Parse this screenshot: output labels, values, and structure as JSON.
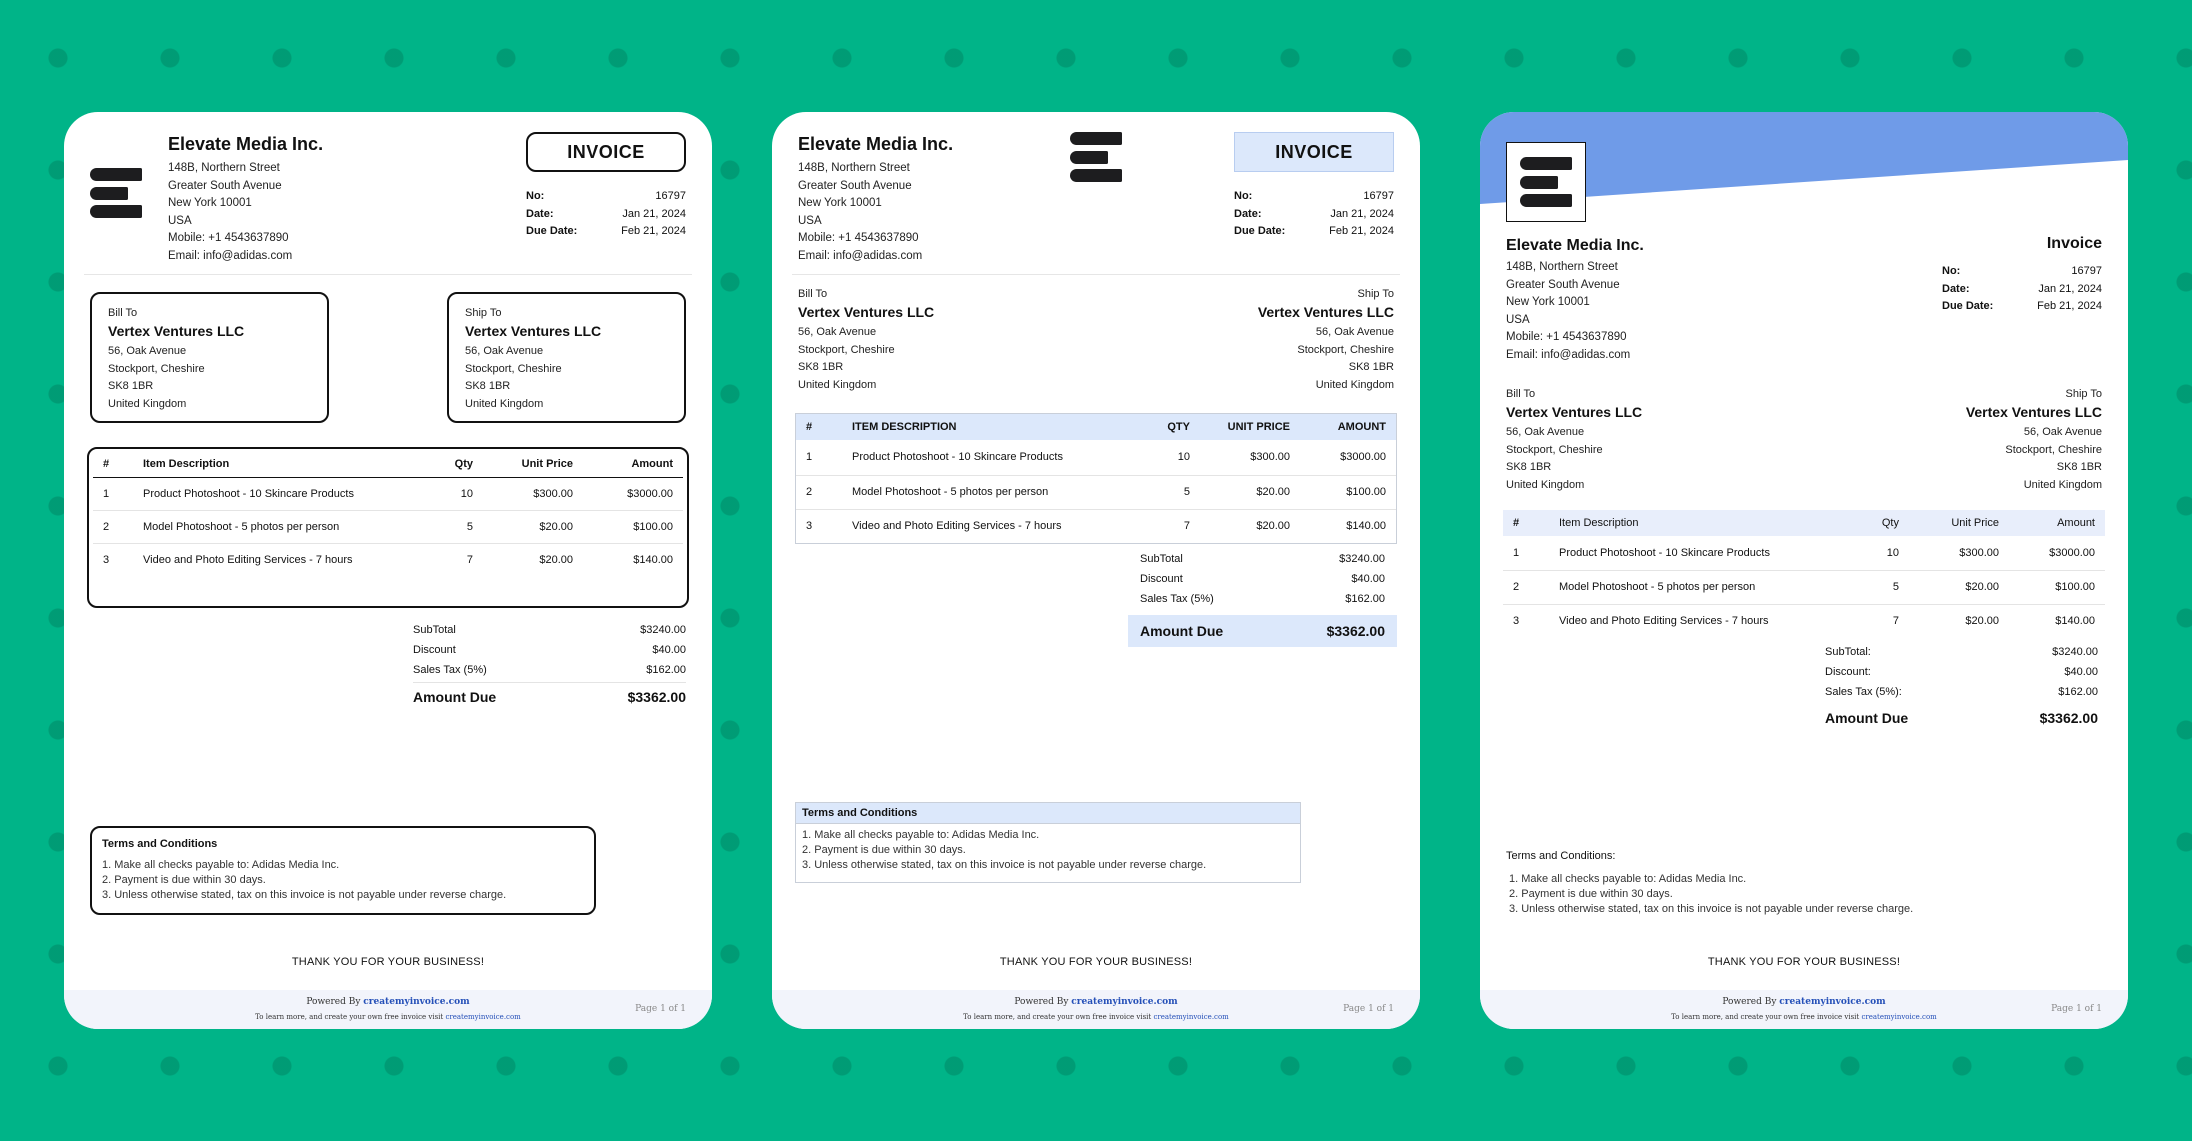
{
  "company": {
    "name": "Elevate Media Inc.",
    "address": [
      "148B, Northern Street",
      "Greater South Avenue",
      "New York 10001",
      "USA"
    ],
    "mobile": "Mobile:  +1 4543637890",
    "email": "Email:  info@adidas.com"
  },
  "invoice": {
    "title_upper": "INVOICE",
    "title_mixed": "Invoice",
    "no_label": "No:",
    "no_value": "16797",
    "date_label": "Date:",
    "date_value": "Jan 21, 2024",
    "due_label": "Due Date:",
    "due_value": "Feb 21, 2024"
  },
  "bill_to": {
    "label": "Bill To",
    "name": "Vertex Ventures LLC",
    "lines": [
      "56, Oak Avenue",
      "Stockport, Cheshire",
      "SK8 1BR",
      "United Kingdom"
    ]
  },
  "ship_to": {
    "label": "Ship To",
    "name": "Vertex Ventures LLC",
    "lines": [
      "56, Oak Avenue",
      "Stockport, Cheshire",
      "SK8 1BR",
      "United Kingdom"
    ]
  },
  "table": {
    "headers": [
      "#",
      "Item Description",
      "Qty",
      "Unit Price",
      "Amount"
    ],
    "headers_upper": [
      "#",
      "ITEM DESCRIPTION",
      "QTY",
      "UNIT PRICE",
      "AMOUNT"
    ],
    "rows": [
      {
        "n": "1",
        "desc": "Product Photoshoot - 10 Skincare Products",
        "qty": "10",
        "price": "$300.00",
        "amount": "$3000.00"
      },
      {
        "n": "2",
        "desc": "Model Photoshoot - 5 photos per person",
        "qty": "5",
        "price": "$20.00",
        "amount": "$100.00"
      },
      {
        "n": "3",
        "desc": "Video and Photo Editing Services - 7 hours",
        "qty": "7",
        "price": "$20.00",
        "amount": "$140.00"
      }
    ]
  },
  "totals": {
    "subtotal_label": "SubTotal",
    "subtotal_label_colon": "SubTotal:",
    "subtotal": "$3240.00",
    "discount_label": "Discount",
    "discount_label_colon": "Discount:",
    "discount": "$40.00",
    "tax_label": "Sales Tax (5%)",
    "tax_label_colon": "Sales Tax (5%):",
    "tax": "$162.00",
    "due_label": "Amount Due",
    "due": "$3362.00"
  },
  "terms": {
    "title": "Terms and Conditions",
    "title_colon": "Terms and Conditions:",
    "items": [
      "1. Make all checks payable to: Adidas Media Inc.",
      "2. Payment is due within 30 days.",
      "3. Unless otherwise stated, tax on this invoice is not payable under reverse charge."
    ]
  },
  "thanks": "THANK YOU FOR YOUR BUSINESS!",
  "footer": {
    "powered_prefix": "Powered By ",
    "powered_link": "createmyinvoice.com",
    "learn_prefix": "To learn more, and create your own free invoice visit ",
    "learn_link": "createmyinvoice.com",
    "page": "Page 1 of 1"
  },
  "colors": {
    "background": "#00b488",
    "accent_blue": "#dce8fb",
    "banner_blue": "#6f9be8",
    "logo": "#1d1d1f"
  }
}
